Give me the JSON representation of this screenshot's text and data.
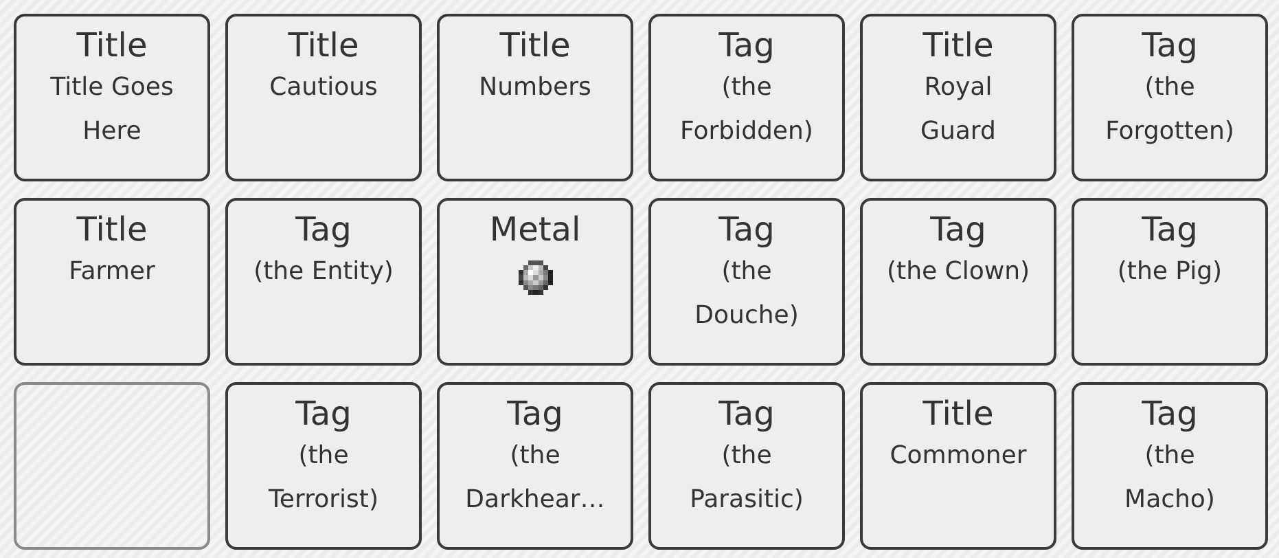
{
  "cells": [
    {
      "kind": "item",
      "heading": "Title",
      "lines": [
        "Title Goes",
        "Here"
      ]
    },
    {
      "kind": "item",
      "heading": "Title",
      "lines": [
        "Cautious"
      ]
    },
    {
      "kind": "item",
      "heading": "Title",
      "lines": [
        "Numbers"
      ]
    },
    {
      "kind": "item",
      "heading": "Tag",
      "lines": [
        "(the",
        "Forbidden)"
      ]
    },
    {
      "kind": "item",
      "heading": "Title",
      "lines": [
        "Royal",
        "Guard"
      ]
    },
    {
      "kind": "item",
      "heading": "Tag",
      "lines": [
        "(the",
        "Forgotten)"
      ]
    },
    {
      "kind": "item",
      "heading": "Title",
      "lines": [
        "Farmer"
      ]
    },
    {
      "kind": "item",
      "heading": "Tag",
      "lines": [
        "(the Entity)"
      ]
    },
    {
      "kind": "metal",
      "heading": "Metal"
    },
    {
      "kind": "item",
      "heading": "Tag",
      "lines": [
        "(the",
        "Douche)"
      ]
    },
    {
      "kind": "item",
      "heading": "Tag",
      "lines": [
        "(the Clown)"
      ]
    },
    {
      "kind": "item",
      "heading": "Tag",
      "lines": [
        "(the Pig)"
      ]
    },
    {
      "kind": "empty"
    },
    {
      "kind": "item",
      "heading": "Tag",
      "lines": [
        "(the",
        "Terrorist)"
      ]
    },
    {
      "kind": "item",
      "heading": "Tag",
      "lines": [
        "(the",
        "Darkhear…"
      ]
    },
    {
      "kind": "item",
      "heading": "Tag",
      "lines": [
        "(the",
        "Parasitic)"
      ]
    },
    {
      "kind": "item",
      "heading": "Title",
      "lines": [
        "Commoner"
      ]
    },
    {
      "kind": "item",
      "heading": "Tag",
      "lines": [
        "(the",
        "Macho)"
      ]
    }
  ]
}
